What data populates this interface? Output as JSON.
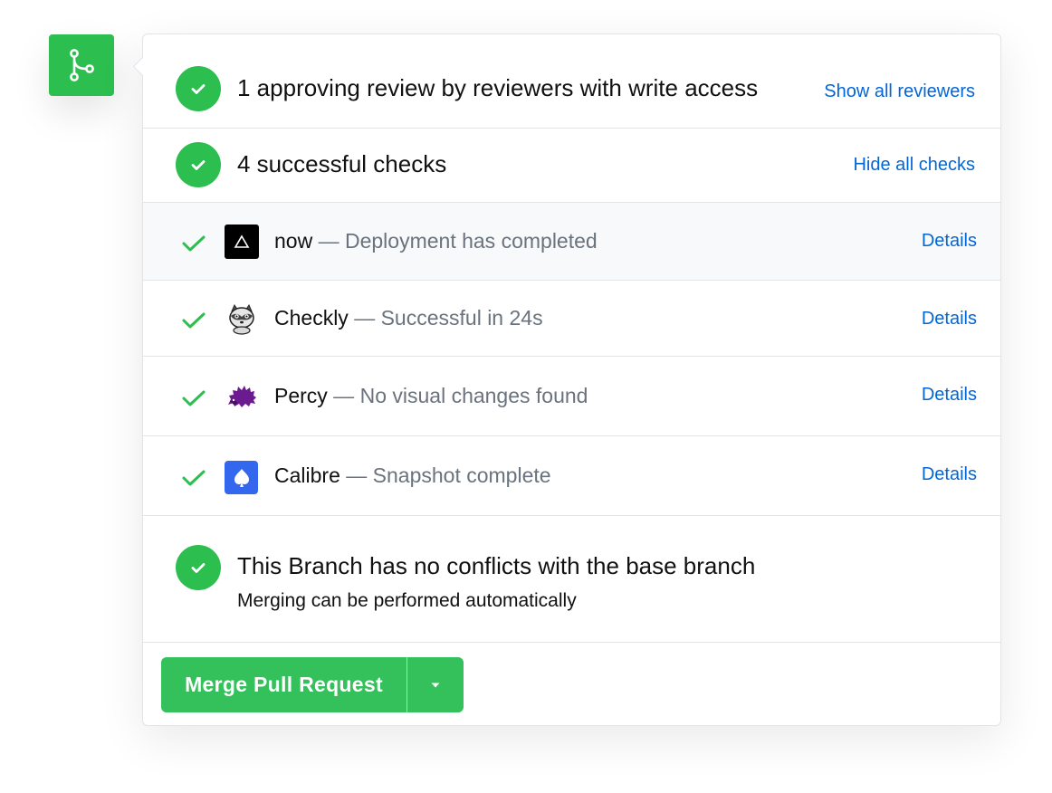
{
  "badge": {
    "icon": "git-merge-icon",
    "color": "#2cbe4e"
  },
  "review": {
    "title": "1 approving review by reviewers with write access",
    "link": "Show all reviewers"
  },
  "checks_summary": {
    "title": "4 successful checks",
    "link": "Hide all checks"
  },
  "checks": [
    {
      "name": "now",
      "separator": " — ",
      "description": "Deployment has completed",
      "details": "Details",
      "logo": "now-triangle-logo"
    },
    {
      "name": "Checkly",
      "separator": " — ",
      "description": "Successful in 24s",
      "details": "Details",
      "logo": "checkly-raccoon-logo"
    },
    {
      "name": "Percy",
      "separator": " — ",
      "description": "No visual changes found",
      "details": "Details",
      "logo": "percy-hedgehog-logo"
    },
    {
      "name": "Calibre",
      "separator": " — ",
      "description": "Snapshot complete",
      "details": "Details",
      "logo": "calibre-spade-logo"
    }
  ],
  "branch": {
    "title": "This Branch has no conflicts with the base branch",
    "subtitle": "Merging can be performed automatically"
  },
  "merge": {
    "label": "Merge Pull Request"
  },
  "colors": {
    "success": "#2cbe4e",
    "link": "#0366d6",
    "muted": "#6a737d"
  }
}
